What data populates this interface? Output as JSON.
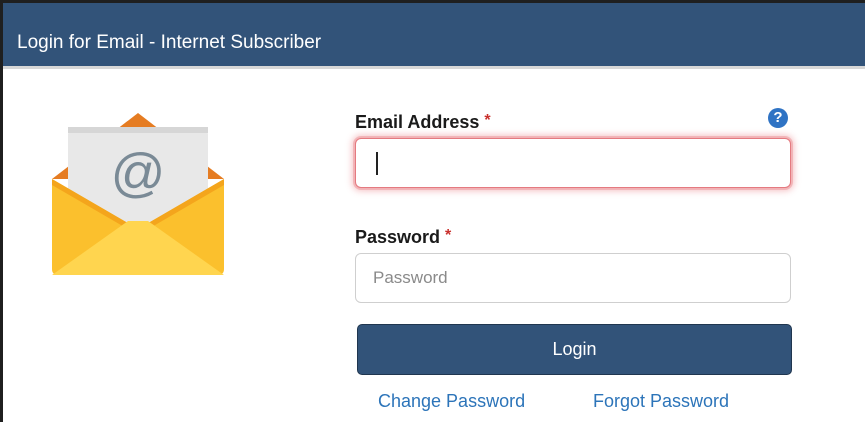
{
  "header": {
    "title": "Login for Email - Internet Subscriber"
  },
  "form": {
    "email": {
      "label": "Email Address",
      "required_mark": "*",
      "value": "",
      "placeholder": ""
    },
    "password": {
      "label": "Password",
      "required_mark": "*",
      "value": "",
      "placeholder": "Password"
    },
    "help_icon": "?",
    "login_label": "Login"
  },
  "links": {
    "change_password": "Change Password",
    "forgot_password": "Forgot Password"
  },
  "icons": {
    "envelope": "email-envelope-icon",
    "help": "question-circle-icon"
  },
  "colors": {
    "header_bg": "#325379",
    "button_bg": "#325379",
    "link": "#2c74b9",
    "required": "#c9302c",
    "help_icon": "#2f73c4",
    "focus_glow": "#e47a80"
  }
}
